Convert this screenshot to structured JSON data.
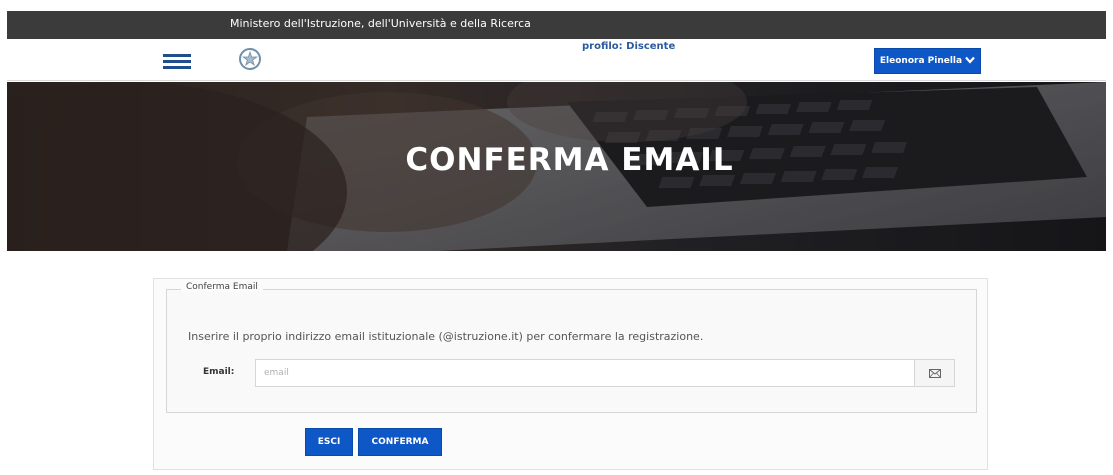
{
  "topbar": {
    "title": "Ministero dell'Istruzione, dell'Università e della Ricerca"
  },
  "header": {
    "menu_icon": "hamburger-icon",
    "emblem_icon": "italian-republic-emblem-icon",
    "profile_text": "profilo: Discente",
    "user_button_label": "Eleonora Pinella",
    "user_button_icon": "chevron-down-icon"
  },
  "hero": {
    "title": "CONFERMA EMAIL"
  },
  "form": {
    "legend": "Conferma Email",
    "instruction": "Inserire il proprio indirizzo email istituzionale (@istruzione.it) per confermare la registrazione.",
    "email_label": "Email:",
    "email_value": "",
    "email_placeholder": "email",
    "email_addon_icon": "envelope-icon"
  },
  "actions": {
    "esci_label": "ESCI",
    "conferma_label": "CONFERMA"
  },
  "colors": {
    "topbar": "#3b3b3b",
    "primary": "#0d57c7",
    "profile_text": "#2c5a9e",
    "hamburger": "#1f4e8c"
  }
}
